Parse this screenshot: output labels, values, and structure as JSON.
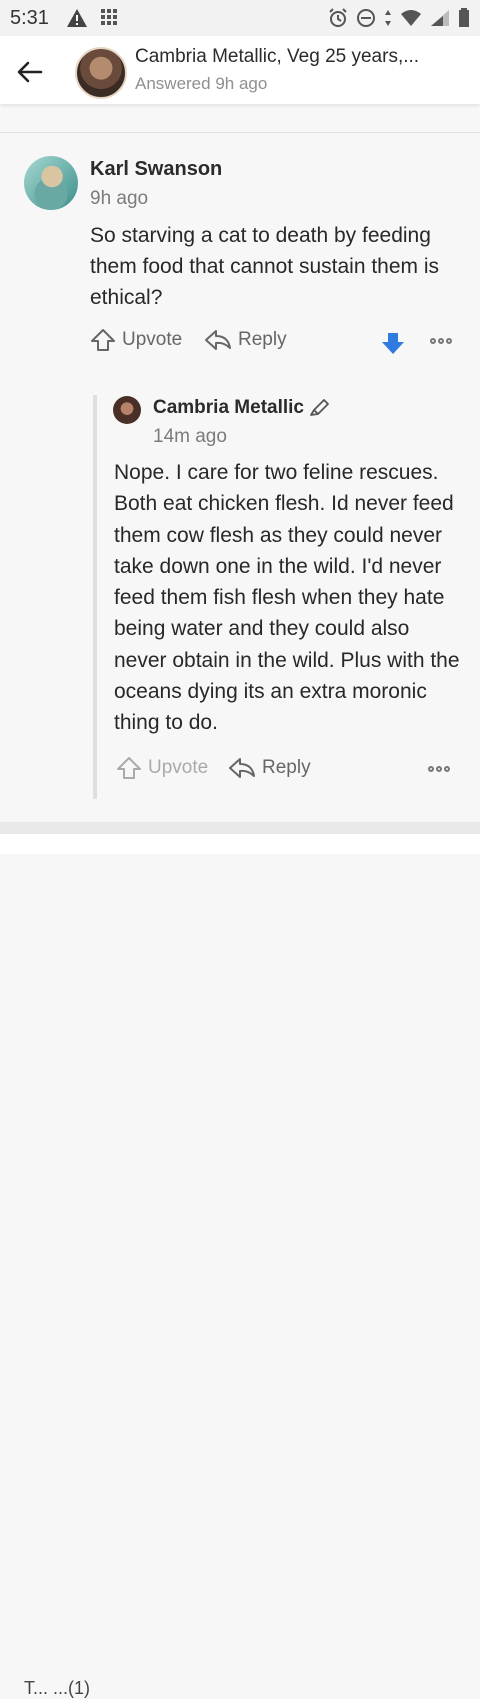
{
  "status_bar": {
    "time": "5:31"
  },
  "header": {
    "title": "Cambria Metallic, Veg 25 years,...",
    "subtitle": "Answered 9h ago"
  },
  "comment": {
    "author": "Karl Swanson",
    "time": "9h ago",
    "text": "So starving a cat to death by feeding them food that cannot sustain them is ethical?",
    "actions": {
      "upvote_label": "Upvote",
      "reply_label": "Reply"
    },
    "downvote_color": "#2f7be0"
  },
  "reply": {
    "author": "Cambria Metallic",
    "time": "14m ago",
    "text": "Nope. I care for two feline rescues. Both eat chicken flesh. Id never feed them cow flesh as they could never take down one in the wild. I'd never feed them fish flesh when they hate being water and they could also never obtain in the wild. Plus with the oceans dying its an extra moronic thing to do.",
    "actions": {
      "upvote_label": "Upvote",
      "reply_label": "Reply"
    }
  },
  "footer": {
    "partial_text": "T... ...(1)"
  }
}
